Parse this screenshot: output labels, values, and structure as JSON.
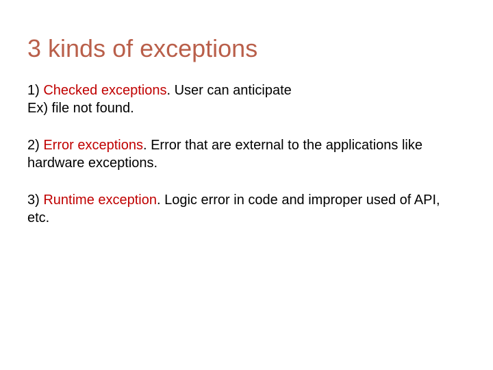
{
  "title": "3 kinds of exceptions",
  "items": [
    {
      "num": "1) ",
      "term": "Checked exceptions",
      "desc": ". User can anticipate",
      "extra": "Ex) file not found."
    },
    {
      "num": "2) ",
      "term": "Error exceptions",
      "desc": ". Error that are external to the applications like hardware exceptions.",
      "extra": ""
    },
    {
      "num": "3) ",
      "term": "Runtime exception",
      "desc": ". Logic error in code and improper used of API, etc.",
      "extra": ""
    }
  ]
}
